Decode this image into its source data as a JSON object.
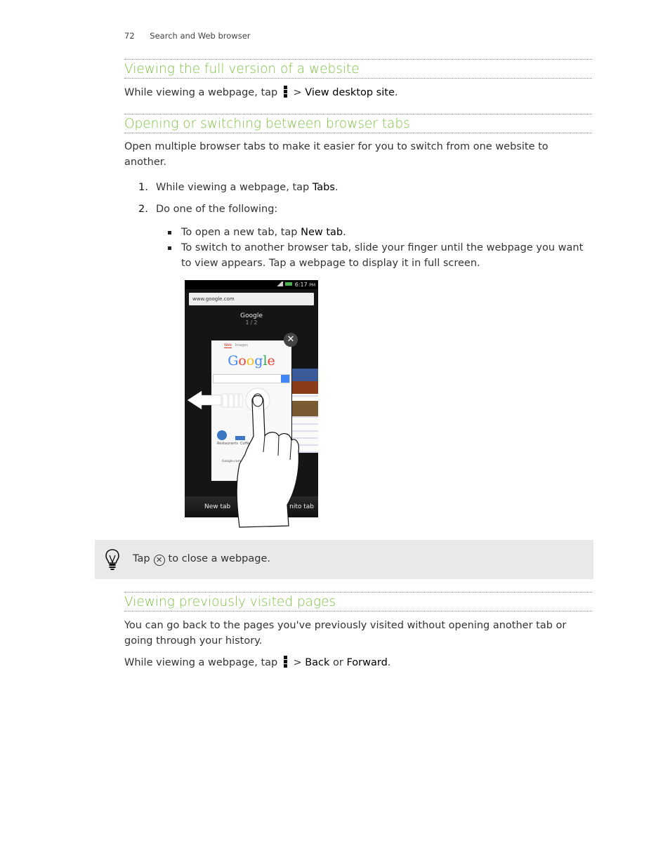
{
  "page_header": {
    "page_number": "72",
    "chapter": "Search and Web browser"
  },
  "sections": {
    "full_version": {
      "heading": "Viewing the full version of a website",
      "instruction_prefix": "While viewing a webpage, tap",
      "instruction_sep": ">",
      "instruction_target": "View desktop site",
      "instruction_end": "."
    },
    "tabs": {
      "heading": "Opening or switching between browser tabs",
      "intro": "Open multiple browser tabs to make it easier for you to switch from one website to another.",
      "steps": [
        {
          "number": "1.",
          "prefix": "While viewing a webpage, tap ",
          "target": "Tabs",
          "suffix": "."
        },
        {
          "number": "2.",
          "text": "Do one of the following:"
        }
      ],
      "bullets": [
        {
          "prefix": "To open a new tab, tap ",
          "target": "New tab",
          "suffix": "."
        },
        {
          "text": "To switch to another browser tab, slide your finger until the webpage you want to view appears. Tap a webpage to display it in full screen."
        }
      ]
    },
    "tip": {
      "prefix": "Tap",
      "suffix": "to close a webpage.",
      "icon": "close-circle-icon"
    },
    "previous_pages": {
      "heading": "Viewing previously visited pages",
      "intro": "You can go back to the pages you've previously visited without opening another tab or going through your history.",
      "instruction_prefix": "While viewing a webpage, tap",
      "instruction_sep": ">",
      "instruction_back": "Back",
      "instruction_or": "or",
      "instruction_forward": "Forward",
      "instruction_end": "."
    }
  },
  "phone_screenshot": {
    "status_time": "6:17",
    "status_ampm": "PM",
    "url": "www.google.com",
    "tab_title": "Google",
    "tab_count": "1 / 2",
    "card_tabs": [
      "Web",
      "Images"
    ],
    "card_logo": "Google",
    "card_icons": [
      "Restaurants",
      "Coffee"
    ],
    "card_footer": "Google.com",
    "bottom_left": "New tab",
    "bottom_right": "Incognito tab",
    "bottom_right_visible": "nito tab"
  },
  "colors": {
    "heading": "#7cc242",
    "tip_background": "#e9e9e9",
    "rule": "#888888"
  }
}
